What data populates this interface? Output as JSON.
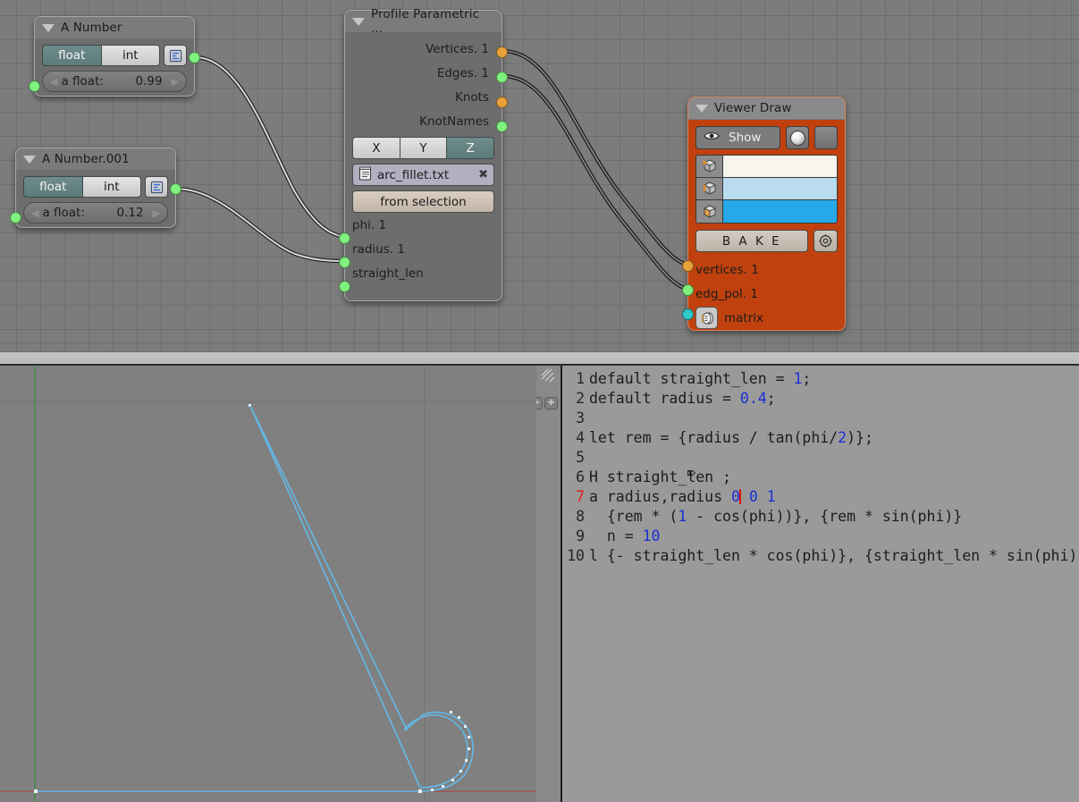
{
  "app": {
    "name": "Blender Sverchok node editor"
  },
  "nodes": {
    "a_number": {
      "title": "A Number",
      "collapse_icon": "triangle-down-icon",
      "type_toggle": {
        "float_label": "float",
        "int_label": "int",
        "active": "float"
      },
      "props_icon": "properties-icon",
      "value_label": "a float:",
      "value": "0.99",
      "left_arrow": "◀",
      "right_arrow": "▶",
      "output_socket": "green"
    },
    "a_number_001": {
      "title": "A Number.001",
      "collapse_icon": "triangle-down-icon",
      "type_toggle": {
        "float_label": "float",
        "int_label": "int",
        "active": "float"
      },
      "props_icon": "properties-icon",
      "value_label": "a float:",
      "value": "0.12",
      "left_arrow": "◀",
      "right_arrow": "▶",
      "output_socket": "green"
    },
    "profile_parametric": {
      "title": "Profile Parametric ...",
      "collapse_icon": "triangle-down-icon",
      "outputs": [
        {
          "label": "Vertices. 1",
          "color": "orange"
        },
        {
          "label": "Edges. 1",
          "color": "green"
        },
        {
          "label": "Knots",
          "color": "orange"
        },
        {
          "label": "KnotNames",
          "color": "green"
        }
      ],
      "axis_buttons": [
        {
          "label": "X",
          "active": false
        },
        {
          "label": "Y",
          "active": false
        },
        {
          "label": "Z",
          "active": true
        }
      ],
      "file_field": {
        "icon": "text-file-icon",
        "name": "arc_fillet.txt",
        "clear_icon": "clear-x-icon"
      },
      "from_selection_label": "from selection",
      "inputs": [
        {
          "label": "phi. 1",
          "color": "green"
        },
        {
          "label": "radius. 1",
          "color": "green"
        },
        {
          "label": "straight_len",
          "color": "green"
        }
      ]
    },
    "viewer_draw": {
      "title": "Viewer Draw",
      "collapse_icon": "triangle-down-icon",
      "show_label": "Show",
      "eye_icon": "eye-icon",
      "sphere_icon": "shading-ball-icon",
      "blank_icon": "blank-button",
      "color_rows": [
        {
          "icon": "vertex-cube-icon",
          "color": "#f7f5ee"
        },
        {
          "icon": "edge-cube-icon",
          "color": "#b9dcf0"
        },
        {
          "icon": "face-cube-icon",
          "color": "#27a8e8"
        }
      ],
      "bake_label": "B A K E",
      "gear_icon": "target-gear-icon",
      "inputs": [
        {
          "label": "vertices. 1",
          "color": "orange",
          "icon": null
        },
        {
          "label": "edg_pol. 1",
          "color": "green",
          "icon": null
        },
        {
          "label": "matrix",
          "color": "cyan",
          "icon": "matrix-icon"
        }
      ],
      "node_color": "#c0410d"
    }
  },
  "viewport": {
    "background": "#808080",
    "axis_x_color": "#9a5050",
    "axis_y_color": "#4a8a4a",
    "curve_color": "#63b8e8",
    "grid_color": "#6f6f6f"
  },
  "text_editor": {
    "gutter_buttons": [
      "plus-icon",
      "plus-icon"
    ],
    "grip_icon": "resize-grip-icon",
    "current_line": 7,
    "lines": [
      {
        "n": 1,
        "text": "default straight_len = 1;"
      },
      {
        "n": 2,
        "text": "default radius = 0.4;"
      },
      {
        "n": 3,
        "text": ""
      },
      {
        "n": 4,
        "text": "let rem = {radius / tan(phi/2)};"
      },
      {
        "n": 5,
        "text": ""
      },
      {
        "n": 6,
        "text": "H straight_len ;"
      },
      {
        "n": 7,
        "text": "a radius,radius 0 0 1"
      },
      {
        "n": 8,
        "text": "  {rem * (1 - cos(phi))}, {rem * sin(phi)}"
      },
      {
        "n": 9,
        "text": "  n = 10"
      },
      {
        "n": 10,
        "text": "l {- straight_len * cos(phi)}, {straight_len * sin(phi)}"
      }
    ]
  }
}
